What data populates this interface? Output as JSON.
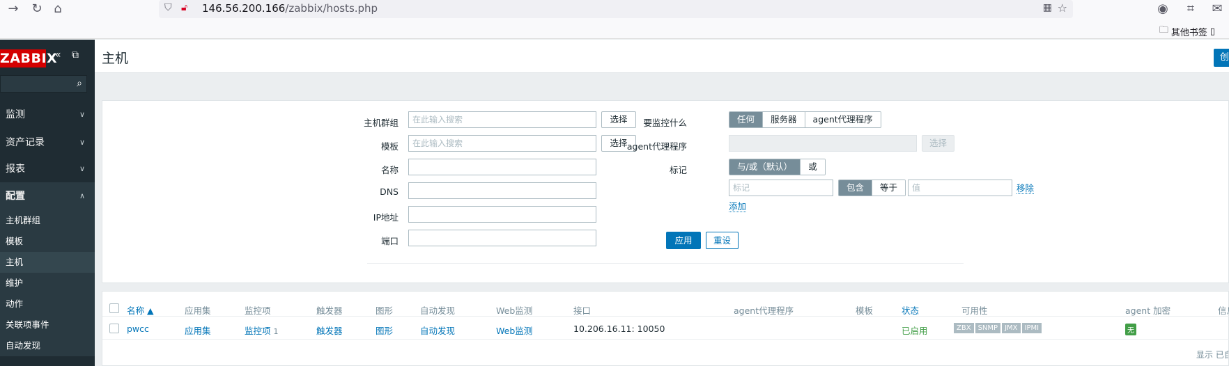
{
  "browser": {
    "url_host": "146.56.200.166",
    "url_path": "/zabbix/hosts.php",
    "bookmark_label": "其他书签"
  },
  "sidebar": {
    "logo": "ZABBIX",
    "menu": [
      {
        "label": "监测"
      },
      {
        "label": "资产记录"
      },
      {
        "label": "报表"
      },
      {
        "label": "配置"
      }
    ],
    "submenu": [
      {
        "label": "主机群组"
      },
      {
        "label": "模板"
      },
      {
        "label": "主机"
      },
      {
        "label": "维护"
      },
      {
        "label": "动作"
      },
      {
        "label": "关联项事件"
      },
      {
        "label": "自动发现"
      }
    ]
  },
  "header": {
    "title": "主机",
    "create_label": "创"
  },
  "filter": {
    "host_group_label": "主机群组",
    "host_group_placeholder": "在此输入搜索",
    "template_label": "模板",
    "template_placeholder": "在此输入搜索",
    "name_label": "名称",
    "dns_label": "DNS",
    "ip_label": "IP地址",
    "port_label": "端口",
    "select_label": "选择",
    "monitored_by_label": "要监控什么",
    "monitored_by_options": [
      "任何",
      "服务器",
      "agent代理程序"
    ],
    "proxy_label": "agent代理程序",
    "tags_label": "标记",
    "tags_mode_options": [
      "与/或（默认）",
      "或"
    ],
    "tag_placeholder": "标记",
    "tag_op_options": [
      "包含",
      "等于"
    ],
    "value_placeholder": "值",
    "remove_label": "移除",
    "add_label": "添加",
    "apply_label": "应用",
    "reset_label": "重设"
  },
  "table": {
    "headers": [
      "名称 ▲",
      "应用集",
      "监控项",
      "触发器",
      "图形",
      "自动发现",
      "Web监测",
      "接口",
      "agent代理程序",
      "模板",
      "状态",
      "可用性",
      "agent 加密",
      "信息"
    ],
    "rows": [
      {
        "name": "pwcc",
        "apps": "应用集",
        "items": "监控项",
        "items_count": "1",
        "triggers": "触发器",
        "graphs": "图形",
        "discovery": "自动发现",
        "web": "Web监测",
        "interface": "10.206.16.11: 10050",
        "status": "已启用",
        "availability": [
          "ZBX",
          "SNMP",
          "JMX",
          "IPMI"
        ],
        "encryption": "无"
      }
    ],
    "footer": "显示 已自"
  }
}
